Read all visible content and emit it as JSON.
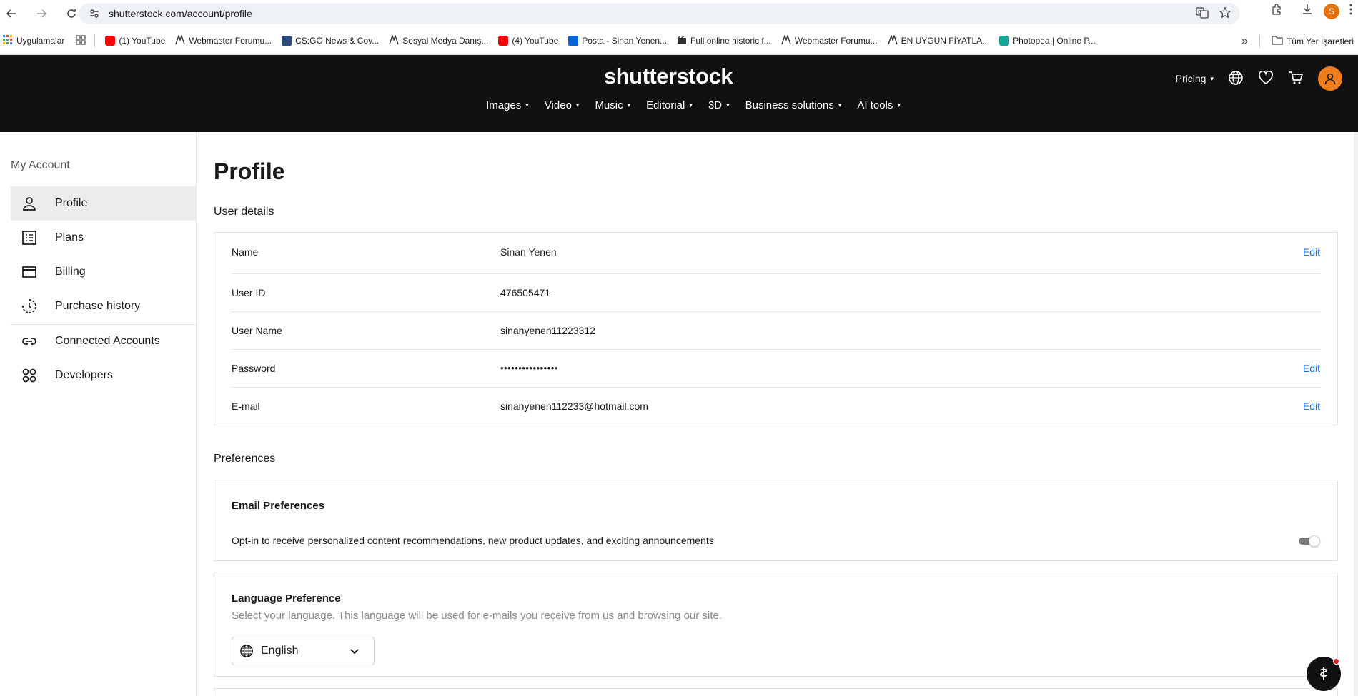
{
  "browser": {
    "url": "shutterstock.com/account/profile",
    "profile_initial": "S",
    "bookmarks": [
      {
        "label": "Uygulamalar",
        "color": "#4285f4"
      },
      {
        "label": "(1) YouTube",
        "color": "#ff0000"
      },
      {
        "label": "Webmaster Forumu...",
        "color": "#333333"
      },
      {
        "label": "CS:GO News & Cov...",
        "color": "#2a4b7c"
      },
      {
        "label": "Sosyal Medya Danış...",
        "color": "#333333"
      },
      {
        "label": "(4) YouTube",
        "color": "#ff0000"
      },
      {
        "label": "Posta - Sinan Yenen...",
        "color": "#0a64d6"
      },
      {
        "label": "Full online historic f...",
        "color": "#333333"
      },
      {
        "label": "Webmaster Forumu...",
        "color": "#333333"
      },
      {
        "label": "EN UYGUN FİYATLA...",
        "color": "#333333"
      },
      {
        "label": "Photopea | Online P...",
        "color": "#18a497"
      }
    ],
    "all_bookmarks": "Tüm Yer İşaretleri",
    "more": "»"
  },
  "site": {
    "logo": "shutterstock",
    "pricing": "Pricing",
    "nav": [
      "Images",
      "Video",
      "Music",
      "Editorial",
      "3D",
      "Business solutions",
      "AI tools"
    ]
  },
  "sidebar": {
    "title": "My Account",
    "items": [
      {
        "label": "Profile",
        "icon": "person-icon",
        "active": true
      },
      {
        "label": "Plans",
        "icon": "list-icon"
      },
      {
        "label": "Billing",
        "icon": "card-icon"
      },
      {
        "label": "Purchase history",
        "icon": "history-icon"
      },
      {
        "label": "Connected Accounts",
        "icon": "link-icon"
      },
      {
        "label": "Developers",
        "icon": "grid-icon"
      }
    ]
  },
  "main": {
    "title": "Profile",
    "user_details_title": "User details",
    "user_details": [
      {
        "key": "Name",
        "value": "Sinan Yenen",
        "edit": "Edit"
      },
      {
        "key": "User ID",
        "value": "476505471",
        "edit": ""
      },
      {
        "key": "User Name",
        "value": "sinanyenen11223312",
        "edit": ""
      },
      {
        "key": "Password",
        "value": "••••••••••••••••",
        "edit": "Edit"
      },
      {
        "key": "E-mail",
        "value": "sinanyenen112233@hotmail.com",
        "edit": "Edit"
      }
    ],
    "preferences_title": "Preferences",
    "email_pref": {
      "heading": "Email Preferences",
      "text": "Opt-in to receive personalized content recommendations, new product updates, and exciting announcements"
    },
    "language_pref": {
      "heading": "Language Preference",
      "sub": "Select your language. This language will be used for e-mails you receive from us and browsing our site.",
      "selected": "English"
    }
  },
  "colors": {
    "header_bg": "#111111",
    "accent_orange": "#f07c1c",
    "link_blue": "#1e6bd6"
  }
}
